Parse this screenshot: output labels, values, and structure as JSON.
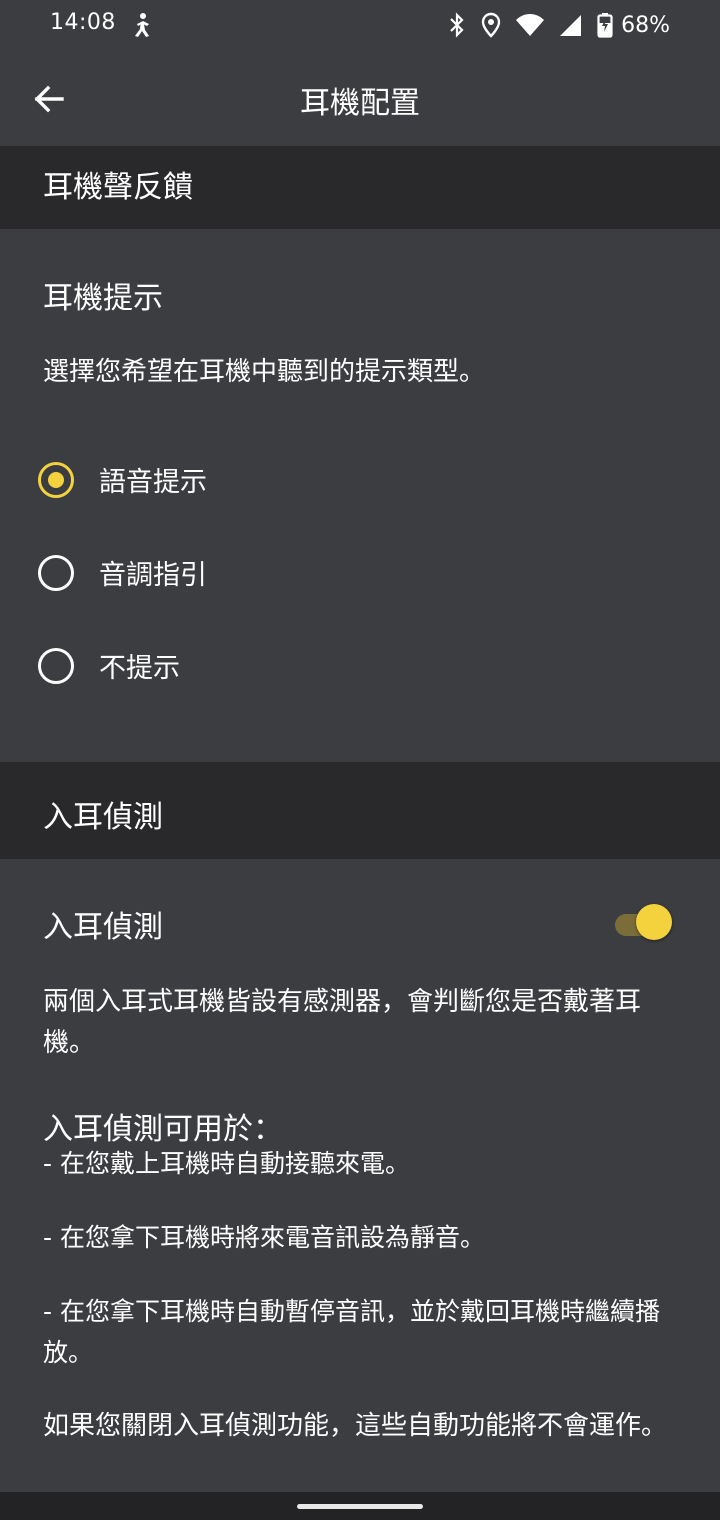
{
  "status_bar": {
    "time": "14:08",
    "left_icon": "accessibility-person-icon",
    "icons": [
      "bluetooth-icon",
      "location-icon",
      "wifi-icon",
      "cell-signal-icon",
      "battery-charging-icon"
    ],
    "battery": "68%"
  },
  "app_bar": {
    "back_icon": "arrow-back-icon",
    "title": "耳機配置"
  },
  "sections": {
    "feedback": {
      "header": "耳機聲反饋",
      "title": "耳機提示",
      "description": "選擇您希望在耳機中聽到的提示類型。",
      "options": [
        {
          "label": "語音提示",
          "selected": true
        },
        {
          "label": "音調指引",
          "selected": false
        },
        {
          "label": "不提示",
          "selected": false
        }
      ]
    },
    "in_ear": {
      "header": "入耳偵測",
      "title": "入耳偵測",
      "toggle_on": true,
      "description": "兩個入耳式耳機皆設有感測器，會判斷您是否戴著耳機。",
      "uses_title": "入耳偵測可用於：",
      "uses": [
        "- 在您戴上耳機時自動接聽來電。",
        "- 在您拿下耳機時將來電音訊設為靜音。",
        "- 在您拿下耳機時自動暫停音訊，並於戴回耳機時繼續播放。"
      ],
      "footer": "如果您關閉入耳偵測功能，這些自動功能將不會運作。"
    }
  },
  "colors": {
    "background": "#3c3d41",
    "section_header": "#29292c",
    "accent": "#f4d23e",
    "toggle_track": "#7a6d39"
  }
}
